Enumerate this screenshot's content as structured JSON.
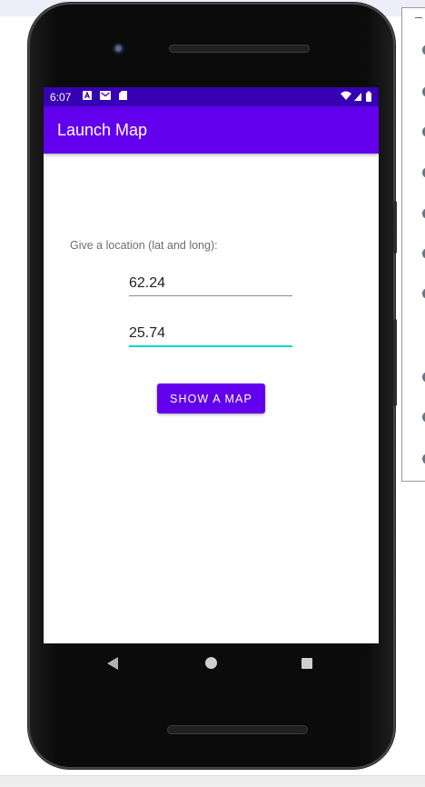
{
  "status_bar": {
    "time": "6:07"
  },
  "app_bar": {
    "title": "Launch Map"
  },
  "form": {
    "prompt": "Give a location (lat and long):",
    "latitude_value": "62.24",
    "longitude_value": "25.74",
    "show_map_label": "SHOW A MAP"
  },
  "colors": {
    "status_bar": "#3700b3",
    "primary": "#6200ee",
    "accent": "#03dac5"
  },
  "icons": [
    "a-notification-icon",
    "mail-icon",
    "sd-card-icon",
    "wifi-icon",
    "cell-signal-icon",
    "battery-icon",
    "nav-back-icon",
    "nav-home-icon",
    "nav-recents-icon"
  ]
}
